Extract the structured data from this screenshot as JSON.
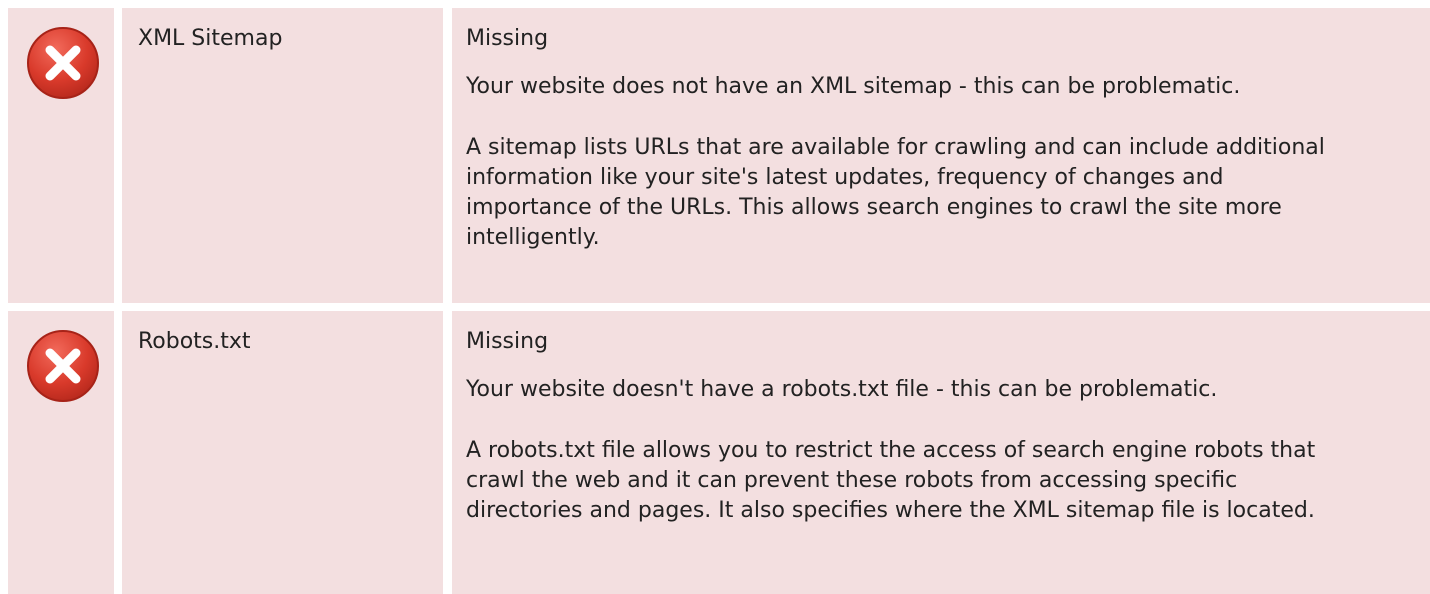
{
  "colors": {
    "row_bg": "#f3dfe0",
    "gutter": "#ffffff",
    "error_icon": "#d93a2b"
  },
  "checks": [
    {
      "icon": "error-x-icon",
      "name": "XML Sitemap",
      "status": "Missing",
      "summary": "Your website does not have an XML sitemap - this can be problematic.",
      "description": "A sitemap lists URLs that are available for crawling and can include additional information like your site's latest updates, frequency of changes and importance of the URLs. This allows search engines to crawl the site more intelligently."
    },
    {
      "icon": "error-x-icon",
      "name": "Robots.txt",
      "status": "Missing",
      "summary": "Your website doesn't have a robots.txt file - this can be problematic.",
      "description": "A robots.txt file allows you to restrict the access of search engine robots that crawl the web and it can prevent these robots from accessing specific directories and pages. It also specifies where the XML sitemap file is located."
    }
  ]
}
